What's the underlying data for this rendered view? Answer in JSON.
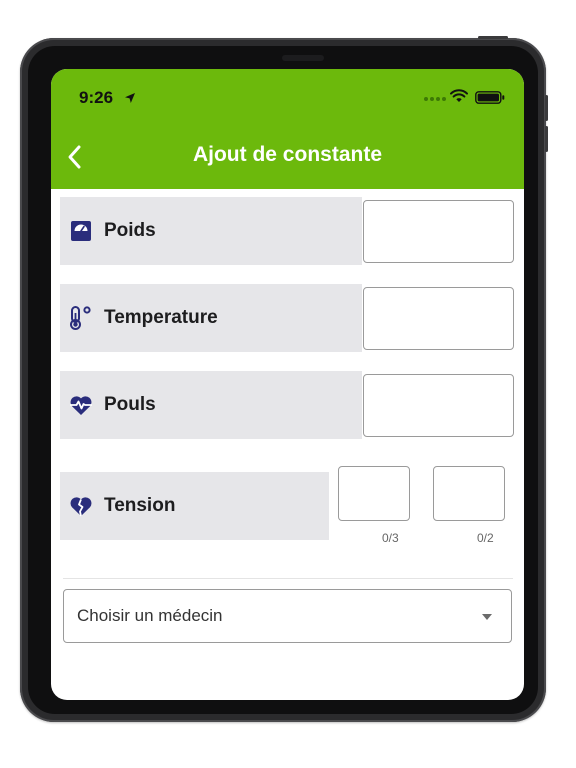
{
  "status_bar": {
    "time": "9:26"
  },
  "header": {
    "title": "Ajout de constante"
  },
  "rows": [
    {
      "label": "Poids",
      "icon": "scale-icon"
    },
    {
      "label": "Temperature",
      "icon": "thermometer-icon"
    },
    {
      "label": "Pouls",
      "icon": "heartbeat-icon"
    },
    {
      "label": "Tension",
      "icon": "broken-heart-icon"
    }
  ],
  "tension": {
    "systolic_counter": "0/3",
    "diastolic_counter": "0/2"
  },
  "doctor_select": {
    "value": "Choisir un médecin"
  },
  "colors": {
    "header": "#6cb90c",
    "icon": "#2a2d7c",
    "label_bg": "#e6e6e9"
  }
}
